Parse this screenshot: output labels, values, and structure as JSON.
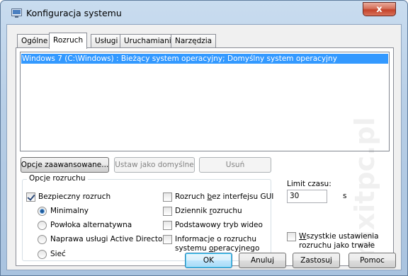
{
  "window": {
    "title": "Konfiguracja systemu",
    "close_glyph": "x",
    "title_icon": "msconfig-icon"
  },
  "tabs": [
    {
      "label": "Ogólne",
      "active": false
    },
    {
      "label": "Rozruch",
      "active": true
    },
    {
      "label": "Usługi",
      "active": false
    },
    {
      "label": "Uruchamianie",
      "active": false
    },
    {
      "label": "Narzędzia",
      "active": false
    }
  ],
  "os_list": {
    "items": [
      {
        "label": "Windows 7 (C:\\Windows) : Bieżący system operacyjny; Domyślny system operacyjny",
        "selected": true
      }
    ]
  },
  "list_buttons": {
    "advanced": "Opcje zaawansowane...",
    "set_default": "Ustaw jako domyślne",
    "delete": "Usuń"
  },
  "boot_options": {
    "legend": "Opcje rozruchu",
    "safe_boot": {
      "label": "Bezpieczny rozruch",
      "checked": true
    },
    "minimal": {
      "label": "Minimalny",
      "checked": true
    },
    "alternate_shell": {
      "label": "Powłoka alternatywna",
      "checked": false
    },
    "ad_repair": {
      "label": "Naprawa usługi Active Directory",
      "checked": false
    },
    "network": {
      "label": "Sieć",
      "checked": false
    },
    "no_gui": {
      "label_pre": "Rozruch ",
      "label_u": "b",
      "label_post": "ez interfejsu GUI",
      "checked": false
    },
    "boot_log": {
      "label_pre": "Dziennik ",
      "label_u": "r",
      "label_post": "ozruchu",
      "checked": false
    },
    "base_video": {
      "label": "Podstawowy tryb wideo",
      "checked": false
    },
    "os_boot_info": {
      "line1": "Informacje o rozruchu",
      "line2_pre": "systemu ",
      "line2_u": "o",
      "line2_post": "peracyjnego",
      "checked": false
    }
  },
  "timeout": {
    "label": "Limit czasu:",
    "value": "30",
    "unit": "s"
  },
  "make_permanent": {
    "line1_pre": "",
    "line1_u": "W",
    "line1_post": "szystkie ustawienia",
    "line2": "rozruchu jako trwałe",
    "checked": false
  },
  "footer": {
    "ok": "OK",
    "cancel": "Anuluj",
    "apply": "Zastosuj",
    "help": "Pomoc"
  },
  "watermark": "mixitpc.pl",
  "colors": {
    "selection": "#3399ff",
    "close_button": "#c4432a",
    "default_button_border": "#3c7fb1"
  }
}
